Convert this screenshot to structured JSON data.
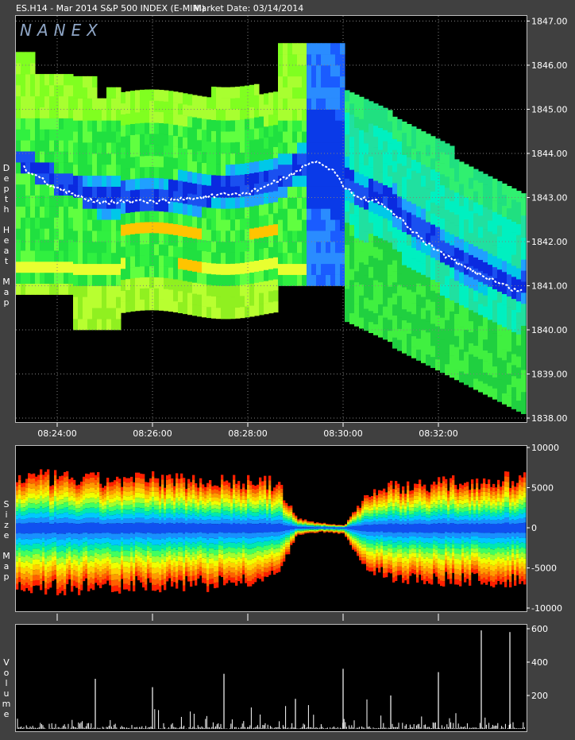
{
  "header": {
    "symbol": "ES.H14 - Mar 2014 S&P 500 INDEX (E-MINI)",
    "market_date": "Market Date: 03/14/2014"
  },
  "brand": "NANEX",
  "panels": {
    "heat_label": "Depth Heat Map",
    "size_label": "Size Map",
    "volume_label": "Volume"
  },
  "colors": {
    "background": "#000000",
    "frame": "#404040",
    "price_line": "#ffffff",
    "heat_low": "#00e000",
    "heat_mid": "#d8ff40",
    "heat_high": "#ffb000",
    "heat_blue": "#0a2ae0",
    "heat_cyan": "#00e0e0"
  },
  "chart_data": [
    {
      "type": "heatmap",
      "title": "Depth Heat Map",
      "x_ticks": [
        "08:24:00",
        "08:26:00",
        "08:28:00",
        "08:30:00",
        "08:32:00"
      ],
      "y_ticks": [
        "1838.00",
        "1839.00",
        "1840.00",
        "1841.00",
        "1842.00",
        "1843.00",
        "1844.00",
        "1845.00",
        "1846.00",
        "1847.00"
      ],
      "ylim": [
        1838.0,
        1847.0
      ],
      "xlim_minutes": [
        8.0,
        33.8
      ],
      "price_path": {
        "t": [
          23.0,
          23.4,
          23.7,
          24.0,
          24.5,
          25.0,
          26.0,
          27.0,
          28.0,
          28.7,
          29.2,
          29.5,
          29.8,
          30.0,
          30.3,
          30.7,
          31.0,
          31.4,
          31.7,
          32.0,
          32.4,
          32.8,
          33.2,
          33.6
        ],
        "price": [
          1843.9,
          1843.6,
          1843.4,
          1843.2,
          1843.0,
          1842.9,
          1842.9,
          1843.0,
          1843.1,
          1843.4,
          1843.7,
          1843.8,
          1843.6,
          1843.3,
          1843.0,
          1842.9,
          1842.7,
          1842.3,
          1842.0,
          1841.8,
          1841.5,
          1841.3,
          1841.1,
          1840.9
        ]
      }
    },
    {
      "type": "area",
      "title": "Size Map",
      "y_ticks": [
        "10000",
        "5000",
        "0",
        "-5000",
        "-10000"
      ],
      "ylim": [
        -10000,
        10000
      ],
      "note_points": {
        "t": [
          23.0,
          24.0,
          25.0,
          26.0,
          27.0,
          28.0,
          28.6,
          29.0,
          29.5,
          30.0,
          30.5,
          31.0,
          32.0,
          33.0,
          33.8
        ],
        "depth_pos": [
          6500,
          6300,
          6000,
          6200,
          6000,
          5800,
          5600,
          1200,
          600,
          300,
          4400,
          5200,
          5600,
          6000,
          6300
        ],
        "depth_neg": [
          -7000,
          -7500,
          -7200,
          -7000,
          -7000,
          -6800,
          -6000,
          -1000,
          -500,
          -800,
          -5200,
          -6000,
          -6400,
          -6500,
          -6600
        ]
      }
    },
    {
      "type": "bar",
      "title": "Volume",
      "y_ticks": [
        "600",
        "400",
        "200"
      ],
      "ylim": [
        0,
        620
      ],
      "notable_spikes": {
        "t": [
          24.8,
          26.0,
          27.5,
          29.0,
          30.0,
          31.0,
          32.0,
          32.9,
          33.5
        ],
        "values": [
          300,
          250,
          330,
          180,
          360,
          200,
          340,
          590,
          580
        ]
      }
    }
  ]
}
